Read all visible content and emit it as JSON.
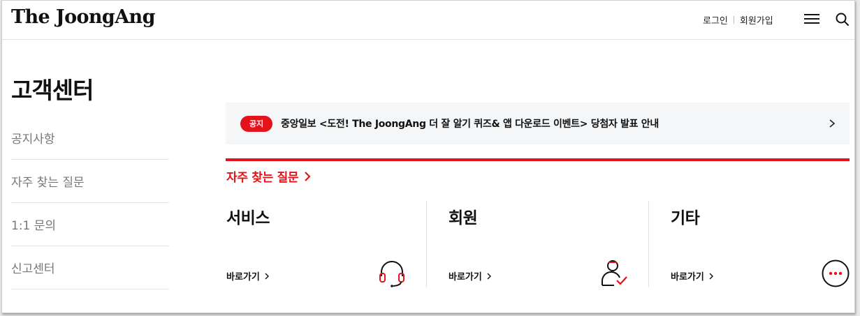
{
  "header": {
    "logo": "The JoongAng",
    "login": "로그인",
    "signup": "회원가입",
    "menu_icon": "hamburger-menu-icon",
    "search_icon": "search-icon"
  },
  "page": {
    "title": "고객센터"
  },
  "sidebar": {
    "items": [
      {
        "label": "공지사항"
      },
      {
        "label": "자주 찾는 질문"
      },
      {
        "label": "1:1 문의"
      },
      {
        "label": "신고센터"
      }
    ]
  },
  "notice": {
    "badge": "공지",
    "text": "중앙일보 <도전! The JoongAng 더 잘 알기 퀴즈& 앱 다운로드 이벤트> 당첨자 발표 안내"
  },
  "faq": {
    "heading": "자주 찾는 질문"
  },
  "categories": [
    {
      "title": "서비스",
      "link": "바로가기",
      "icon": "headset-icon"
    },
    {
      "title": "회원",
      "link": "바로가기",
      "icon": "user-check-icon"
    },
    {
      "title": "기타",
      "link": "바로가기",
      "icon": "more-dots-icon"
    }
  ],
  "colors": {
    "accent": "#e4121a",
    "notice_bg": "#f4f6f8",
    "text": "#111111",
    "muted": "#777777"
  }
}
